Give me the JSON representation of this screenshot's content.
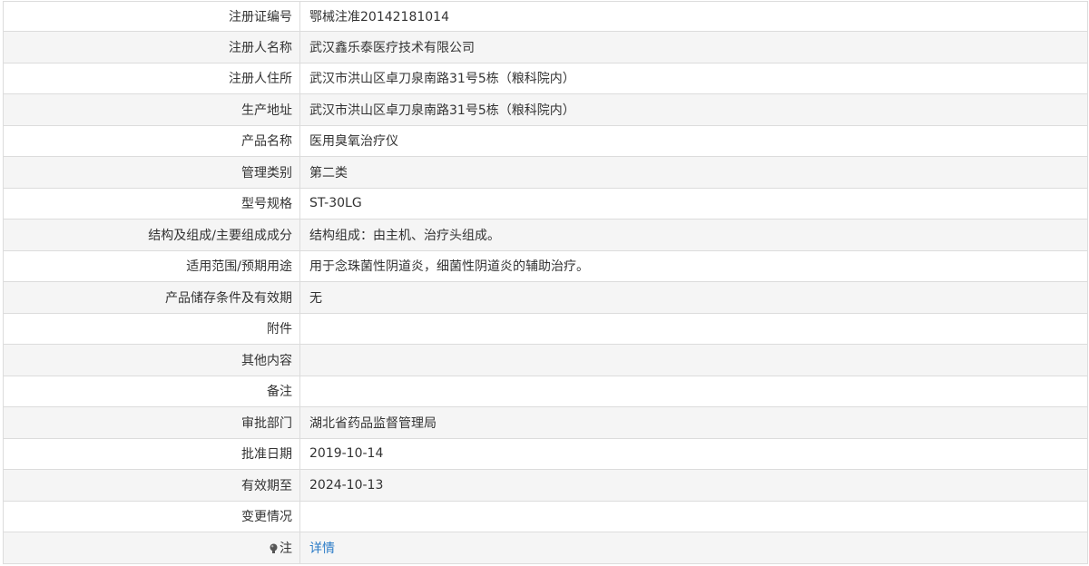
{
  "rows": [
    {
      "label": "注册证编号",
      "value": "鄂械注准20142181014"
    },
    {
      "label": "注册人名称",
      "value": "武汉鑫乐泰医疗技术有限公司"
    },
    {
      "label": "注册人住所",
      "value": "武汉市洪山区卓刀泉南路31号5栋（粮科院内）"
    },
    {
      "label": "生产地址",
      "value": "武汉市洪山区卓刀泉南路31号5栋（粮科院内）"
    },
    {
      "label": "产品名称",
      "value": "医用臭氧治疗仪"
    },
    {
      "label": "管理类别",
      "value": "第二类"
    },
    {
      "label": "型号规格",
      "value": "ST-30LG"
    },
    {
      "label": "结构及组成/主要组成成分",
      "value": "结构组成：由主机、治疗头组成。"
    },
    {
      "label": "适用范围/预期用途",
      "value": "用于念珠菌性阴道炎，细菌性阴道炎的辅助治疗。"
    },
    {
      "label": "产品储存条件及有效期",
      "value": "无"
    },
    {
      "label": "附件",
      "value": ""
    },
    {
      "label": "其他内容",
      "value": ""
    },
    {
      "label": "备注",
      "value": ""
    },
    {
      "label": "审批部门",
      "value": "湖北省药品监督管理局"
    },
    {
      "label": "批准日期",
      "value": "2019-10-14"
    },
    {
      "label": "有效期至",
      "value": "2024-10-13"
    },
    {
      "label": "变更情况",
      "value": ""
    }
  ],
  "note": {
    "label": "注",
    "icon": "note-bulb-icon",
    "link_text": "详情"
  }
}
